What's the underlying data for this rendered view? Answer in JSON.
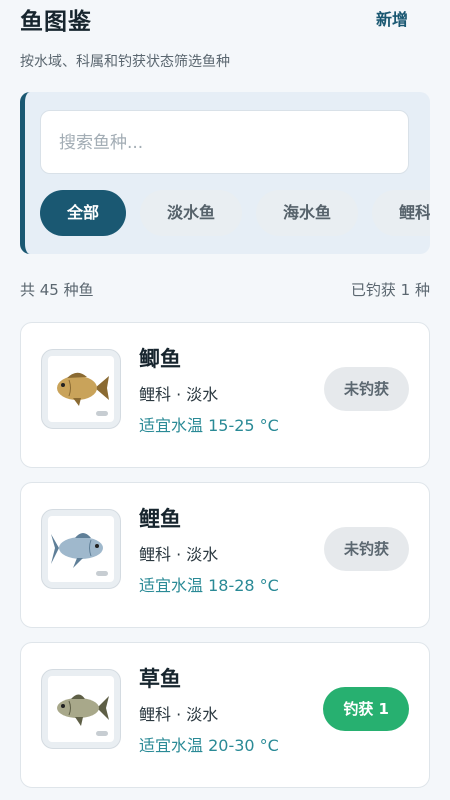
{
  "header": {
    "title": "鱼图鉴",
    "add_label": "新增",
    "subtitle": "按水域、科属和钓获状态筛选鱼种"
  },
  "search": {
    "placeholder": "搜索鱼种..."
  },
  "filters": [
    {
      "label": "全部",
      "active": true
    },
    {
      "label": "淡水鱼",
      "active": false
    },
    {
      "label": "海水鱼",
      "active": false
    },
    {
      "label": "鲤科",
      "active": false
    }
  ],
  "summary": {
    "total": "共 45 种鱼",
    "caught": "已钓获 1 种"
  },
  "fish": [
    {
      "name": "鲫鱼",
      "meta": "鲤科 · 淡水",
      "temp": "适宜水温 15-25 °C",
      "status": "未钓获",
      "caught": false,
      "icon": "crucian-carp-icon",
      "colors": {
        "body": "#c9a35a",
        "fin": "#8a6a32"
      }
    },
    {
      "name": "鲤鱼",
      "meta": "鲤科 · 淡水",
      "temp": "适宜水温 18-28 °C",
      "status": "未钓获",
      "caught": false,
      "icon": "carp-icon",
      "colors": {
        "body": "#9fb8cc",
        "fin": "#5f7f98"
      }
    },
    {
      "name": "草鱼",
      "meta": "鲤科 · 淡水",
      "temp": "适宜水温 20-30 °C",
      "status": "钓获 1",
      "caught": true,
      "icon": "grass-carp-icon",
      "colors": {
        "body": "#a8a88a",
        "fin": "#5e5f46"
      }
    }
  ]
}
